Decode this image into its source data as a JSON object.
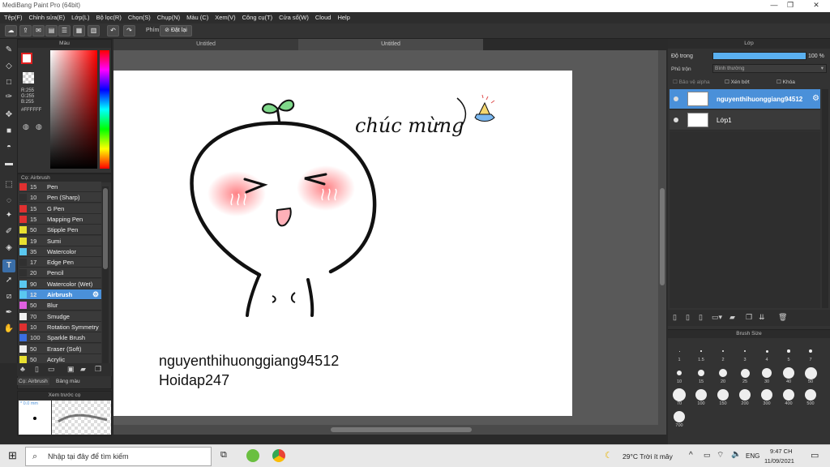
{
  "window": {
    "title": "MediBang Paint Pro (64bit)",
    "minimize": "—",
    "maximize": "❐",
    "close": "✕"
  },
  "menu": [
    "Tệp(F)",
    "Chỉnh sửa(E)",
    "Lớp(L)",
    "Bộ lọc(R)",
    "Chọn(S)",
    "Chụp(N)",
    "Màu (C)",
    "Xem(V)",
    "Công cụ(T)",
    "Cửa sổ(W)",
    "Cloud",
    "Help"
  ],
  "toolbar": {
    "snap_label": "Phím",
    "snap_off_label": "Đặt lại"
  },
  "doc_tabs": [
    "Untitled",
    "Untitled"
  ],
  "color_panel": {
    "title": "Màu",
    "rgb": [
      "R:255",
      "G:255",
      "B:255"
    ],
    "hex": "#FFFFFF"
  },
  "brush_panel": {
    "title": "Cọ: Airbrush",
    "brushes": [
      {
        "size": "15",
        "name": "Pen",
        "color": "#e03030"
      },
      {
        "size": "10",
        "name": "Pen (Sharp)",
        "color": "#303030"
      },
      {
        "size": "15",
        "name": "G Pen",
        "color": "#e03030"
      },
      {
        "size": "15",
        "name": "Mapping Pen",
        "color": "#e03030"
      },
      {
        "size": "50",
        "name": "Stipple Pen",
        "color": "#e8e030"
      },
      {
        "size": "19",
        "name": "Sumi",
        "color": "#e8e030"
      },
      {
        "size": "35",
        "name": "Watercolor",
        "color": "#5ac8f0"
      },
      {
        "size": "17",
        "name": "Edge Pen",
        "color": "#303030"
      },
      {
        "size": "20",
        "name": "Pencil",
        "color": "#303030"
      },
      {
        "size": "90",
        "name": "Watercolor (Wet)",
        "color": "#5ac8f0"
      },
      {
        "size": "12",
        "name": "Airbrush",
        "color": "#5ac8f0",
        "selected": true
      },
      {
        "size": "50",
        "name": "Blur",
        "color": "#e060e0"
      },
      {
        "size": "70",
        "name": "Smudge",
        "color": "#f0f0f0"
      },
      {
        "size": "10",
        "name": "Rotation Symmetry",
        "color": "#e03030"
      },
      {
        "size": "100",
        "name": "Sparkle Brush",
        "color": "#3a6ee0"
      },
      {
        "size": "50",
        "name": "Eraser (Soft)",
        "color": "#f0f0f0"
      },
      {
        "size": "50",
        "name": "Acrylic",
        "color": "#e8e030"
      }
    ],
    "tabs": [
      "Cọ: Airbrush",
      "Bảng màu"
    ]
  },
  "preview_panel": {
    "title": "Xem trước cọ",
    "size_label": "* 0.0 mm"
  },
  "layer_panel": {
    "title": "Lớp",
    "opacity_label": "Độ trong",
    "opacity_value": "100 %",
    "blend_label": "Phủ trộn",
    "blend_value": "Bình thường",
    "protect_alpha": "Bảo vệ alpha",
    "clipping": "Xén bớt",
    "lock": "Khóa",
    "layers": [
      {
        "name": "nguyenthihuonggiang94512",
        "selected": true
      },
      {
        "name": "Lớp1",
        "selected": false
      }
    ]
  },
  "brush_size_panel": {
    "title": "Brush Size",
    "sizes": [
      "1",
      "1.5",
      "2",
      "3",
      "4",
      "5",
      "7",
      "10",
      "15",
      "20",
      "25",
      "30",
      "40",
      "50",
      "70",
      "100",
      "150",
      "200",
      "300",
      "400",
      "500",
      "700"
    ]
  },
  "artwork": {
    "caption_text": "chúc mừng",
    "username": "nguyenthihuonggiang94512",
    "site": "Hoidap247"
  },
  "taskbar": {
    "search_placeholder": "Nhập tại đây để tìm kiếm",
    "weather": "29°C  Trời ít mây",
    "lang": "ENG",
    "time": "9:47 CH",
    "date": "11/09/2021"
  }
}
